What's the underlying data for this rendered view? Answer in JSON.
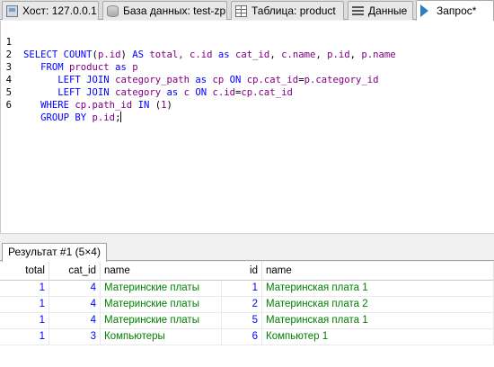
{
  "tabs": [
    {
      "label": "Хост: 127.0.0.1",
      "icon": "server-icon"
    },
    {
      "label": "База данных: test-zp",
      "icon": "database-icon"
    },
    {
      "label": "Таблица: product",
      "icon": "table-icon"
    },
    {
      "label": "Данные",
      "icon": "data-icon"
    },
    {
      "label": "Запрос*",
      "icon": "query-play-icon"
    }
  ],
  "editor": {
    "line_numbers": [
      "1",
      "2",
      "3",
      "4",
      "5",
      "6"
    ],
    "lines": [
      [
        {
          "t": "SELECT COUNT",
          "c": "kw"
        },
        {
          "t": "(",
          "c": "txt"
        },
        {
          "t": "p.id",
          "c": "ident"
        },
        {
          "t": ") ",
          "c": "txt"
        },
        {
          "t": "AS",
          "c": "kw"
        },
        {
          "t": " total, ",
          "c": "ident"
        },
        {
          "t": "c.id",
          "c": "ident"
        },
        {
          "t": " as ",
          "c": "kw"
        },
        {
          "t": "cat_id",
          "c": "ident"
        },
        {
          "t": ", ",
          "c": "txt"
        },
        {
          "t": "c.name",
          "c": "ident"
        },
        {
          "t": ", ",
          "c": "txt"
        },
        {
          "t": "p.id",
          "c": "ident"
        },
        {
          "t": ", ",
          "c": "txt"
        },
        {
          "t": "p.name",
          "c": "ident"
        }
      ],
      [
        {
          "t": "   FROM ",
          "c": "kw"
        },
        {
          "t": "product",
          "c": "tbl"
        },
        {
          "t": " as ",
          "c": "kw"
        },
        {
          "t": "p",
          "c": "ident"
        }
      ],
      [
        {
          "t": "      LEFT JOIN ",
          "c": "kw"
        },
        {
          "t": "category_path",
          "c": "tbl"
        },
        {
          "t": " as ",
          "c": "kw"
        },
        {
          "t": "cp ",
          "c": "ident"
        },
        {
          "t": "ON ",
          "c": "kw"
        },
        {
          "t": "cp.cat_id",
          "c": "ident"
        },
        {
          "t": "=",
          "c": "txt"
        },
        {
          "t": "p.category_id",
          "c": "ident"
        }
      ],
      [
        {
          "t": "      LEFT JOIN ",
          "c": "kw"
        },
        {
          "t": "category",
          "c": "tbl"
        },
        {
          "t": " as ",
          "c": "kw"
        },
        {
          "t": "c ",
          "c": "ident"
        },
        {
          "t": "ON ",
          "c": "kw"
        },
        {
          "t": "c.id",
          "c": "ident"
        },
        {
          "t": "=",
          "c": "txt"
        },
        {
          "t": "cp.cat_id",
          "c": "ident"
        }
      ],
      [
        {
          "t": "   WHERE ",
          "c": "kw"
        },
        {
          "t": "cp.path_id",
          "c": "ident"
        },
        {
          "t": " IN ",
          "c": "kw"
        },
        {
          "t": "(",
          "c": "txt"
        },
        {
          "t": "1",
          "c": "num"
        },
        {
          "t": ")",
          "c": "txt"
        }
      ],
      [
        {
          "t": "   GROUP BY ",
          "c": "kw"
        },
        {
          "t": "p.id",
          "c": "ident"
        },
        {
          "t": ";",
          "c": "txt"
        }
      ]
    ]
  },
  "result": {
    "tab_label": "Результат #1 (5×4)",
    "columns": [
      "total",
      "cat_id",
      "name",
      "id",
      "name"
    ],
    "rows": [
      [
        "1",
        "4",
        "Материнские платы",
        "1",
        "Материнская плата 1"
      ],
      [
        "1",
        "4",
        "Материнские платы",
        "2",
        "Материнская плата 2"
      ],
      [
        "1",
        "4",
        "Материнские платы",
        "5",
        "Материнская плата 1"
      ],
      [
        "1",
        "3",
        "Компьютеры",
        "6",
        "Компьютер 1"
      ]
    ]
  },
  "colors": {
    "keyword": "#0000ff",
    "identifier": "#800080",
    "number_cell": "#0000ff",
    "string_cell": "#008000"
  }
}
